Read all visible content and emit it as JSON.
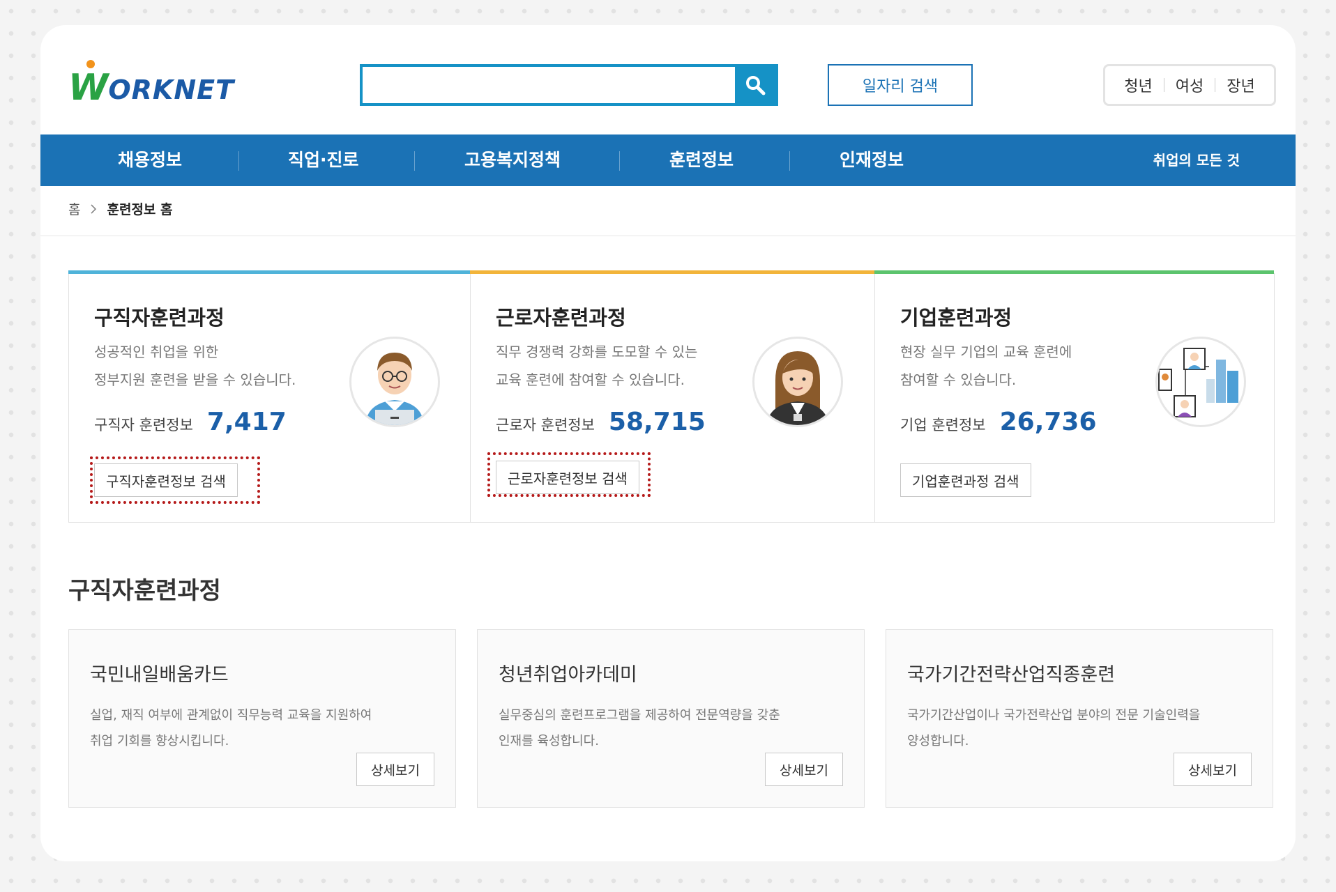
{
  "header": {
    "logo_w": "W",
    "logo_rest": "ORKNET",
    "search_placeholder": "",
    "job_search_label": "일자리 검색",
    "target_links": [
      "청년",
      "여성",
      "장년"
    ]
  },
  "nav": {
    "menus": [
      "채용정보",
      "직업·진로",
      "고용복지정책",
      "훈련정보",
      "인재정보"
    ],
    "all_label": "취업의 모든 것"
  },
  "breadcrumb": {
    "home": "홈",
    "current": "훈련정보 홈"
  },
  "cards": [
    {
      "title": "구직자훈련과정",
      "desc_line1": "성공적인 취업을 위한",
      "desc_line2": "정부지원 훈련을 받을 수 있습니다.",
      "stat_label": "구직자 훈련정보",
      "stat_value": "7,417",
      "button": "구직자훈련정보 검색",
      "accent": "#4fb3d9"
    },
    {
      "title": "근로자훈련과정",
      "desc_line1": "직무 경쟁력 강화를 도모할 수 있는",
      "desc_line2": "교육 훈련에 참여할 수 있습니다.",
      "stat_label": "근로자 훈련정보",
      "stat_value": "58,715",
      "button": "근로자훈련정보 검색",
      "accent": "#f2b43a"
    },
    {
      "title": "기업훈련과정",
      "desc_line1": "현장 실무 기업의 교육 훈련에",
      "desc_line2": "참여할 수 있습니다.",
      "stat_label": "기업 훈련정보",
      "stat_value": "26,736",
      "button": "기업훈련과정 검색",
      "accent": "#5cc46d"
    }
  ],
  "section": {
    "title": "구직자훈련과정",
    "programs": [
      {
        "title": "국민내일배움카드",
        "desc_line1": "실업, 재직 여부에 관계없이 직무능력 교육을 지원하여",
        "desc_line2": "취업 기회를 향상시킵니다.",
        "more": "상세보기"
      },
      {
        "title": "청년취업아카데미",
        "desc_line1": "실무중심의 훈련프로그램을 제공하여 전문역량을 갖춘",
        "desc_line2": "인재를 육성합니다.",
        "more": "상세보기"
      },
      {
        "title": "국가기간전략산업직종훈련",
        "desc_line1": "국가기간산업이나 국가전략산업 분야의 전문 기술인력을",
        "desc_line2": "양성합니다.",
        "more": "상세보기"
      }
    ]
  },
  "colors": {
    "primary": "#1b72b5",
    "search_border": "#1592c6",
    "highlight": "#b51a1a"
  }
}
